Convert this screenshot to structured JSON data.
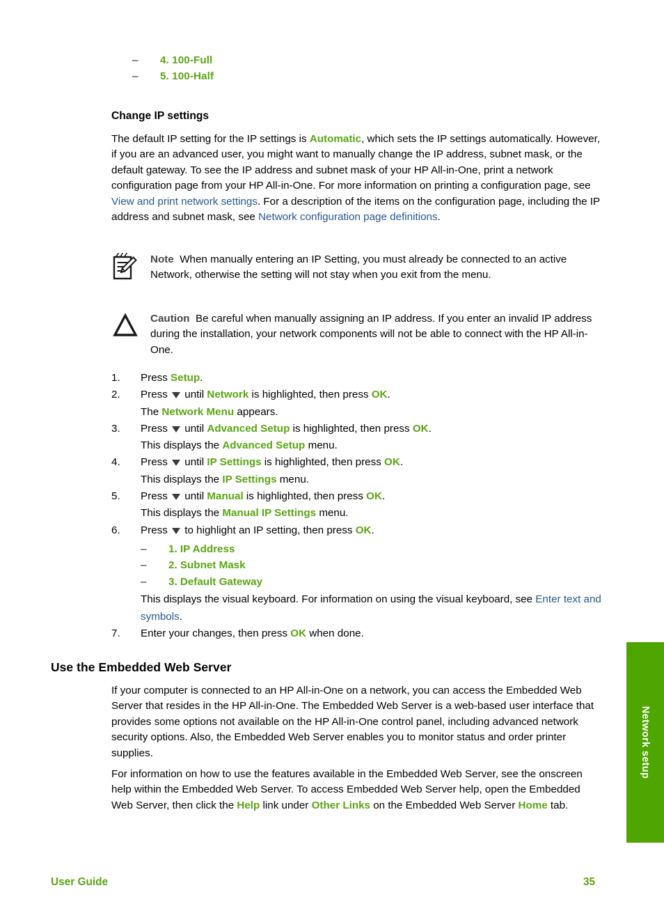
{
  "page": {
    "number": "35",
    "footer_left": "User Guide",
    "side_tab_label": "Network setup"
  },
  "colors": {
    "green": "#5aa512",
    "tab_green": "#4fa600",
    "link_blue": "#28568f",
    "label_gray": "#444444"
  },
  "top_options": {
    "dash": "–",
    "items": [
      {
        "label": "4. 100-Full"
      },
      {
        "label": "5. 100-Half"
      }
    ]
  },
  "section_change_ip": {
    "heading": "Change IP settings",
    "intro": {
      "s1": "The default IP setting for the IP settings is ",
      "green1": "Automatic",
      "s2": ", which sets the IP settings automatically. However, if you are an advanced user, you might want to manually change the IP address, subnet mask, or the default gateway. To see the IP address and subnet mask of your HP All-in-One, print a network configuration page from your HP All-in-One. For more information on printing a configuration page, see ",
      "link1": "View and print network settings",
      "s3": ". For a description of the items on the configuration page, including the IP address and subnet mask, see ",
      "link2": "Network configuration page definitions",
      "s4": "."
    },
    "note": {
      "icon": "note-pad-pencil-icon",
      "label": "Note",
      "text": "When manually entering an IP Setting, you must already be connected to an active Network, otherwise the setting will not stay when you exit from the menu."
    },
    "caution": {
      "icon": "caution-triangle-icon",
      "label": "Caution",
      "text": "Be careful when manually assigning an IP address. If you enter an invalid IP address during the installation, your network components will not be able to connect with the HP All-in-One."
    },
    "steps": [
      {
        "num": "1.",
        "parts": [
          {
            "t": "Press ",
            "style": "plain"
          },
          {
            "t": "Setup",
            "style": "green"
          },
          {
            "t": ".",
            "style": "plain"
          }
        ]
      },
      {
        "num": "2.",
        "parts": [
          {
            "t": "Press ",
            "style": "plain"
          },
          {
            "t": "",
            "style": "arrow"
          },
          {
            "t": " until ",
            "style": "plain"
          },
          {
            "t": "Network",
            "style": "green"
          },
          {
            "t": " is highlighted, then press ",
            "style": "plain"
          },
          {
            "t": "OK",
            "style": "green"
          },
          {
            "t": ".",
            "style": "plain"
          }
        ],
        "sub": [
          {
            "t": "The ",
            "style": "plain"
          },
          {
            "t": "Network Menu",
            "style": "green"
          },
          {
            "t": " appears.",
            "style": "plain"
          }
        ]
      },
      {
        "num": "3.",
        "parts": [
          {
            "t": "Press ",
            "style": "plain"
          },
          {
            "t": "",
            "style": "arrow"
          },
          {
            "t": " until ",
            "style": "plain"
          },
          {
            "t": "Advanced Setup",
            "style": "green"
          },
          {
            "t": " is highlighted, then press ",
            "style": "plain"
          },
          {
            "t": "OK",
            "style": "green"
          },
          {
            "t": ".",
            "style": "plain"
          }
        ],
        "sub": [
          {
            "t": "This displays the ",
            "style": "plain"
          },
          {
            "t": "Advanced Setup",
            "style": "green"
          },
          {
            "t": " menu.",
            "style": "plain"
          }
        ]
      },
      {
        "num": "4.",
        "parts": [
          {
            "t": "Press ",
            "style": "plain"
          },
          {
            "t": "",
            "style": "arrow"
          },
          {
            "t": " until ",
            "style": "plain"
          },
          {
            "t": "IP Settings",
            "style": "green"
          },
          {
            "t": " is highlighted, then press ",
            "style": "plain"
          },
          {
            "t": "OK",
            "style": "green"
          },
          {
            "t": ".",
            "style": "plain"
          }
        ],
        "sub": [
          {
            "t": "This displays the ",
            "style": "plain"
          },
          {
            "t": "IP Settings",
            "style": "green"
          },
          {
            "t": " menu.",
            "style": "plain"
          }
        ]
      },
      {
        "num": "5.",
        "parts": [
          {
            "t": "Press ",
            "style": "plain"
          },
          {
            "t": "",
            "style": "arrow"
          },
          {
            "t": " until ",
            "style": "plain"
          },
          {
            "t": "Manual",
            "style": "green"
          },
          {
            "t": " is highlighted, then press ",
            "style": "plain"
          },
          {
            "t": "OK",
            "style": "green"
          },
          {
            "t": ".",
            "style": "plain"
          }
        ],
        "sub": [
          {
            "t": "This displays the ",
            "style": "plain"
          },
          {
            "t": "Manual IP Settings",
            "style": "green"
          },
          {
            "t": " menu.",
            "style": "plain"
          }
        ]
      },
      {
        "num": "6.",
        "parts": [
          {
            "t": "Press ",
            "style": "plain"
          },
          {
            "t": "",
            "style": "arrow"
          },
          {
            "t": " to highlight an IP setting, then press ",
            "style": "plain"
          },
          {
            "t": "OK",
            "style": "green"
          },
          {
            "t": ".",
            "style": "plain"
          }
        ],
        "options": {
          "dash": "–",
          "items": [
            {
              "label": "1. IP Address"
            },
            {
              "label": "2. Subnet Mask"
            },
            {
              "label": "3. Default Gateway"
            }
          ]
        },
        "note_parts": [
          {
            "t": "This displays the visual keyboard. For information on using the visual keyboard, see ",
            "style": "plain"
          },
          {
            "t": "Enter text and symbols",
            "style": "link"
          },
          {
            "t": ".",
            "style": "plain"
          }
        ]
      },
      {
        "num": "7.",
        "parts": [
          {
            "t": "Enter your changes, then press ",
            "style": "plain"
          },
          {
            "t": "OK",
            "style": "green"
          },
          {
            "t": " when done.",
            "style": "plain"
          }
        ]
      }
    ]
  },
  "section_ews": {
    "heading": "Use the Embedded Web Server",
    "para1": "If your computer is connected to an HP All-in-One on a network, you can access the Embedded Web Server that resides in the HP All-in-One. The Embedded Web Server is a web-based user interface that provides some options not available on the HP All-in-One control panel, including advanced network security options. Also, the Embedded Web Server enables you to monitor status and order printer supplies.",
    "para2": {
      "s1": "For information on how to use the features available in the Embedded Web Server, see the onscreen help within the Embedded Web Server. To access Embedded Web Server help, open the Embedded Web Server, then click the ",
      "green1": "Help",
      "s2": " link under ",
      "green2": "Other Links",
      "s3": " on the Embedded Web Server ",
      "green3": "Home",
      "s4": " tab."
    }
  }
}
